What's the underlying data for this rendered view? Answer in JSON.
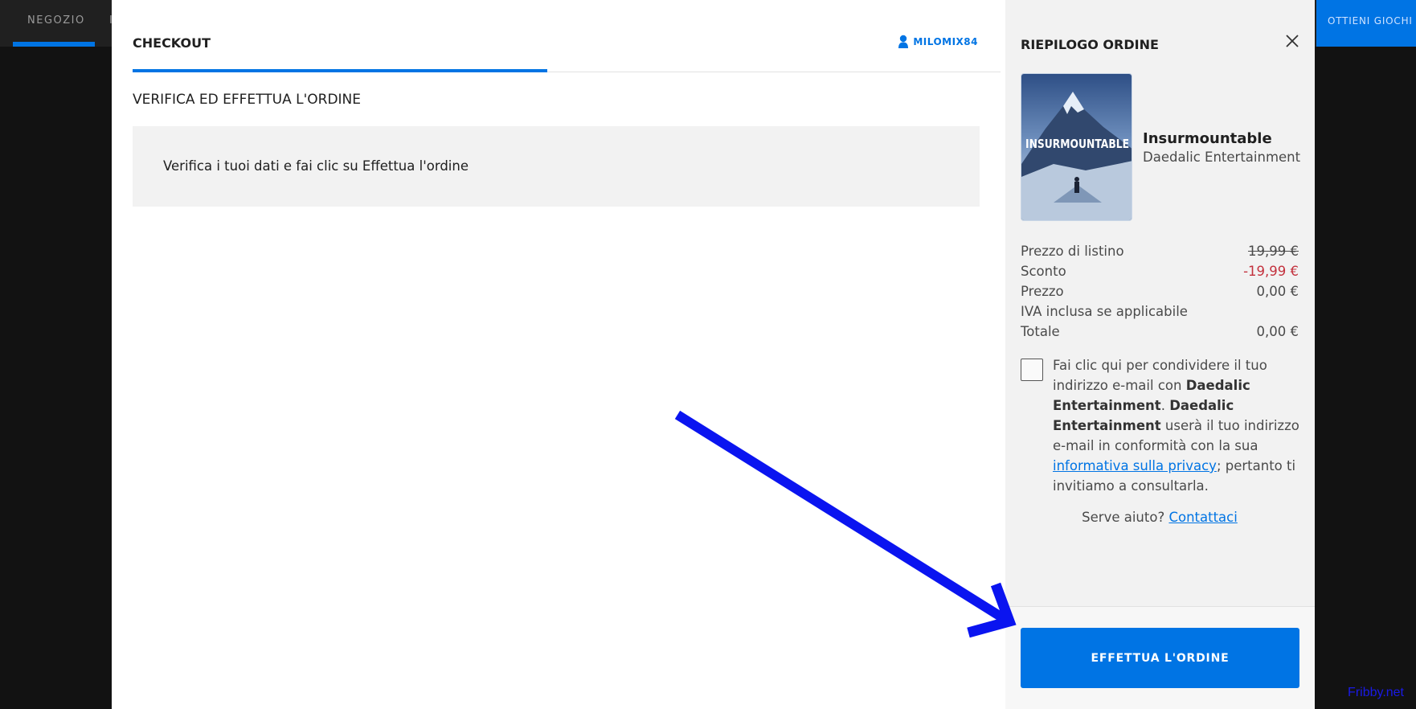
{
  "store_nav": {
    "negozio": "NEGOZIO",
    "partial_item": "I",
    "cta": "OTTIENI GIOCHI E"
  },
  "checkout": {
    "tab": "CHECKOUT",
    "username": "MILOMIX84",
    "section_title": "VERIFICA ED EFFETTUA L'ORDINE",
    "info_text": "Verifica i tuoi dati e fai clic su Effettua l'ordine"
  },
  "summary": {
    "title": "RIEPILOGO ORDINE",
    "game": {
      "title": "Insurmountable",
      "publisher": "Daedalic Entertainment",
      "cover_text": "INSURMOUNTABLE"
    },
    "prices": [
      {
        "label": "Prezzo di listino",
        "value": "19,99 €"
      },
      {
        "label": "Sconto",
        "value": "-19,99 €"
      },
      {
        "label": "Prezzo",
        "value": "0,00 €"
      },
      {
        "label": "IVA inclusa se applicabile",
        "value": ""
      },
      {
        "label": "Totale",
        "value": "0,00 €"
      }
    ],
    "consent": {
      "part1": "Fai clic qui per condividere il tuo indirizzo e-mail con ",
      "bold1": "Daedalic Entertainment",
      "part2": ". ",
      "bold2": "Daedalic Entertainment",
      "part3": " userà il tuo indirizzo e-mail in conformità con la sua ",
      "link": "informativa sulla privacy",
      "part4": "; pertanto ti invitiamo a consultarla."
    },
    "help_text": "Serve aiuto? ",
    "help_link": "Contattaci",
    "place_order": "EFFETTUA L'ORDINE"
  },
  "watermark": "Fribby.net",
  "colors": {
    "accent": "#0074e4",
    "discount": "#c3313d",
    "annotation_arrow": "#0a14f0"
  }
}
